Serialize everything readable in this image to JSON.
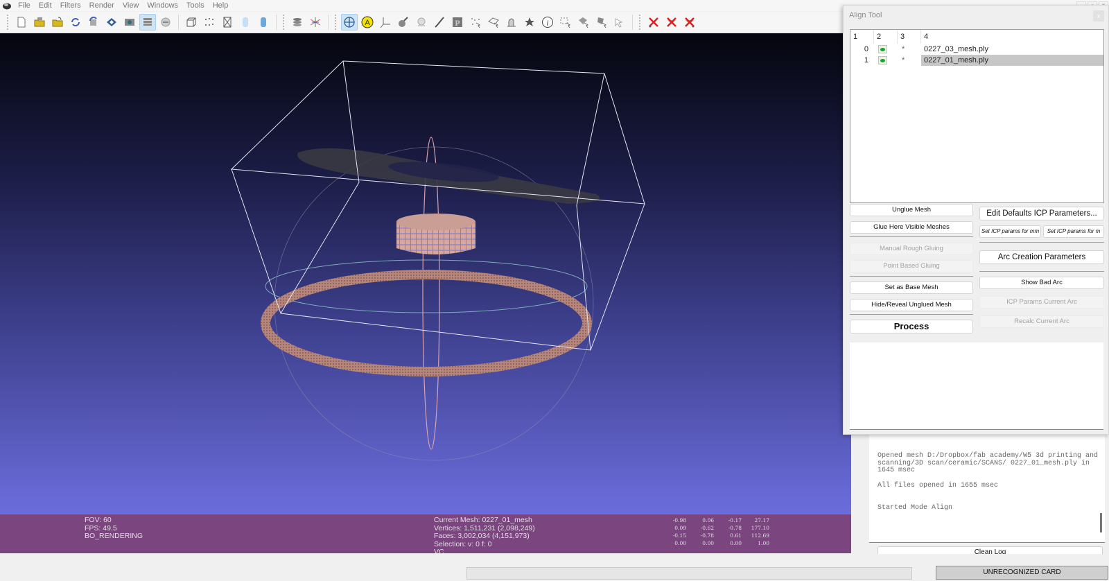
{
  "menubar": {
    "items": [
      "File",
      "Edit",
      "Filters",
      "Render",
      "View",
      "Windows",
      "Tools",
      "Help"
    ]
  },
  "toolbar": {
    "groups": [
      [
        "new-project-icon",
        "open-project-icon",
        "import-mesh-icon",
        "reload-icon",
        "reload-all-icon",
        "save-icon",
        "snapshot-icon",
        "layers-icon",
        "raster-layers-icon"
      ],
      [
        "bbox-icon",
        "points-icon",
        "wireframe-icon",
        "flat-shading-icon",
        "smooth-shading-icon"
      ],
      [
        "color-mode-icon",
        "normals-icon"
      ],
      [
        "trackball-icon",
        "annotation-icon",
        "axis-icon",
        "paint-icon",
        "camera-icon",
        "brush-icon",
        "photo-icon",
        "select-vertices-icon",
        "select-faces-icon",
        "align-icon",
        "georef-icon",
        "info-icon",
        "select-region-icon",
        "select-face-connected-icon",
        "select-face-paint-icon",
        "select-mesh-icon"
      ],
      [
        "delete-vertices-icon",
        "delete-faces-icon",
        "delete-both-icon"
      ]
    ],
    "active": [
      "layers-icon",
      "trackball-icon"
    ]
  },
  "viewport": {
    "background_top": "#05060e",
    "background_bottom": "#6c6ddd",
    "mesh_color": "#b8857a",
    "shadow_color": "#3a3a44"
  },
  "info": {
    "left": [
      "FOV: 60",
      "FPS:    49.5",
      "BO_RENDERING"
    ],
    "mid": [
      "Current Mesh: 0227_01_mesh",
      "Vertices: 1,511,231    (2,098,249)",
      "Faces: 3,002,034    (4,151,973)",
      "Selection: v: 0 f: 0",
      "VC"
    ],
    "matrix": [
      [
        "-0.98",
        "0.06",
        "-0.17",
        "27.17"
      ],
      [
        "0.09",
        "-0.62",
        "-0.78",
        "177.10"
      ],
      [
        "-0.15",
        "-0.78",
        "0.61",
        "112.69"
      ],
      [
        "0.00",
        "0.00",
        "0.00",
        "1.00"
      ]
    ]
  },
  "align_tool": {
    "title": "Align Tool",
    "close_label": "x",
    "columns": [
      "1",
      "2",
      "3",
      "4"
    ],
    "rows": [
      {
        "id": "0",
        "visible": true,
        "mark": "*",
        "name": "0227_03_mesh.ply",
        "selected": false
      },
      {
        "id": "1",
        "visible": true,
        "mark": "*",
        "name": "0227_01_mesh.ply",
        "selected": true
      }
    ],
    "buttons": {
      "unglue": "Unglue Mesh",
      "glue_visible": "Glue Here Visible Meshes",
      "manual_rough": "Manual Rough Gluing",
      "point_based": "Point Based Gluing",
      "set_base": "Set as Base Mesh",
      "hide_reveal": "Hide/Reveal Unglued Mesh",
      "process": "Process",
      "edit_icp": "Edit Defaults ICP Parameters...",
      "icp_mm": "Set ICP params for mm",
      "icp_m": "Set ICP params for m",
      "arc_params": "Arc Creation Parameters",
      "show_bad_arc": "Show Bad Arc",
      "icp_current_arc": "ICP Params Current Arc",
      "recalc_arc": "Recalc Current Arc"
    }
  },
  "log": {
    "lines": [
      "Opened mesh D:/Dropbox/fab academy/W5 3d printing and scanning/3D scan/ceramic/SCANS/ 0227_01_mesh.ply in 1645 msec",
      "All files opened in 1655 msec",
      "Started Mode Align"
    ],
    "clean_label": "Clean Log"
  },
  "status": {
    "card_label": "UNRECOGNIZED CARD"
  },
  "window_controls": [
    "_",
    "▫",
    "x"
  ]
}
